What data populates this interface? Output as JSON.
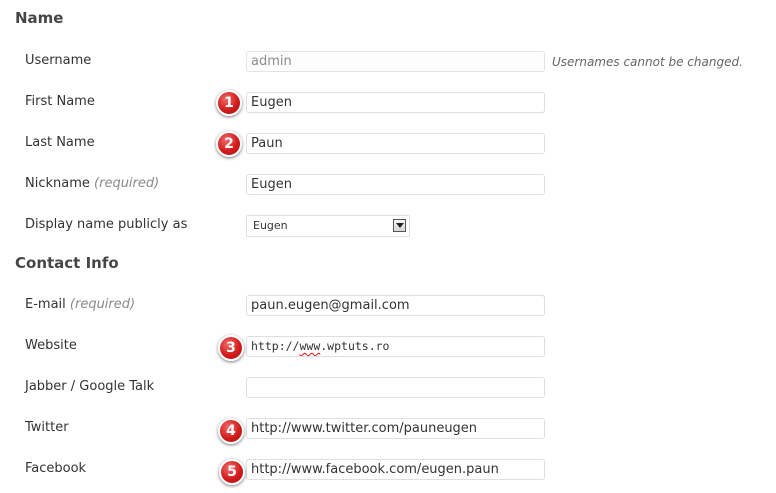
{
  "sections": {
    "name_title": "Name",
    "contact_title": "Contact Info"
  },
  "fields": {
    "username": {
      "label": "Username",
      "value": "admin",
      "note": "Usernames cannot be changed."
    },
    "first_name": {
      "label": "First Name",
      "value": "Eugen",
      "badge": "1"
    },
    "last_name": {
      "label": "Last Name",
      "value": "Paun",
      "badge": "2"
    },
    "nickname": {
      "label": "Nickname",
      "required": "(required)",
      "value": "Eugen"
    },
    "display_name": {
      "label": "Display name publicly as",
      "selected": "Eugen"
    },
    "email": {
      "label": "E-mail",
      "required": "(required)",
      "value": "paun.eugen@gmail.com"
    },
    "website": {
      "label": "Website",
      "value_prefix": "http://",
      "value_spell": "www",
      "value_suffix": ".wptuts.ro",
      "badge": "3"
    },
    "jabber": {
      "label": "Jabber / Google Talk",
      "value": ""
    },
    "twitter": {
      "label": "Twitter",
      "value": "http://www.twitter.com/pauneugen",
      "badge": "4"
    },
    "facebook": {
      "label": "Facebook",
      "value": "http://www.facebook.com/eugen.paun",
      "badge": "5"
    }
  },
  "colors": {
    "badge": "#d21c1c",
    "heading": "#464646",
    "border": "#dfdfdf"
  }
}
